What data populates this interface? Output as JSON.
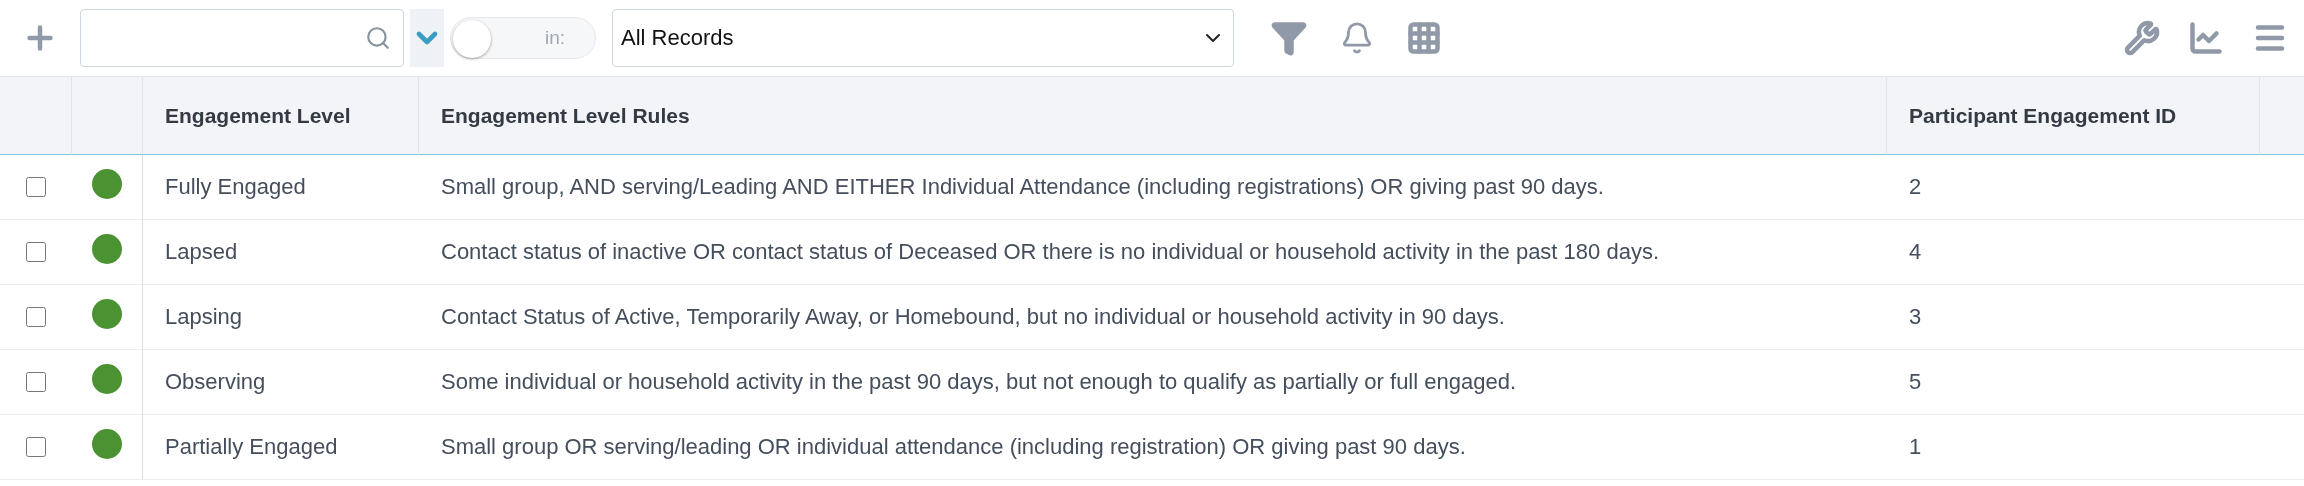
{
  "toolbar": {
    "toggle": {
      "label": "in:",
      "on": false
    },
    "view_select": {
      "value": "All Records"
    }
  },
  "table": {
    "columns": [
      "Engagement Level",
      "Engagement Level Rules",
      "Participant Engagement ID"
    ],
    "rows": [
      {
        "checked": false,
        "color": "#4a9232",
        "level": "Fully Engaged",
        "rules": "Small group, AND serving/Leading AND EITHER Individual Attendance (including registrations) OR giving past 90 days.",
        "id": "2"
      },
      {
        "checked": false,
        "color": "#4a9232",
        "level": "Lapsed",
        "rules": "Contact status of inactive OR contact status of Deceased OR there is no individual or household activity in the past 180 days.",
        "id": "4"
      },
      {
        "checked": false,
        "color": "#4a9232",
        "level": "Lapsing",
        "rules": "Contact Status of Active, Temporarily Away, or Homebound, but no individual or household activity in 90 days.",
        "id": "3"
      },
      {
        "checked": false,
        "color": "#4a9232",
        "level": "Observing",
        "rules": "Some individual or household activity in the past 90 days, but not enough to qualify as partially or full engaged.",
        "id": "5"
      },
      {
        "checked": false,
        "color": "#4a9232",
        "level": "Partially Engaged",
        "rules": "Small group OR serving/leading OR individual attendance (including registration) OR giving past 90 days.",
        "id": "1"
      }
    ]
  }
}
